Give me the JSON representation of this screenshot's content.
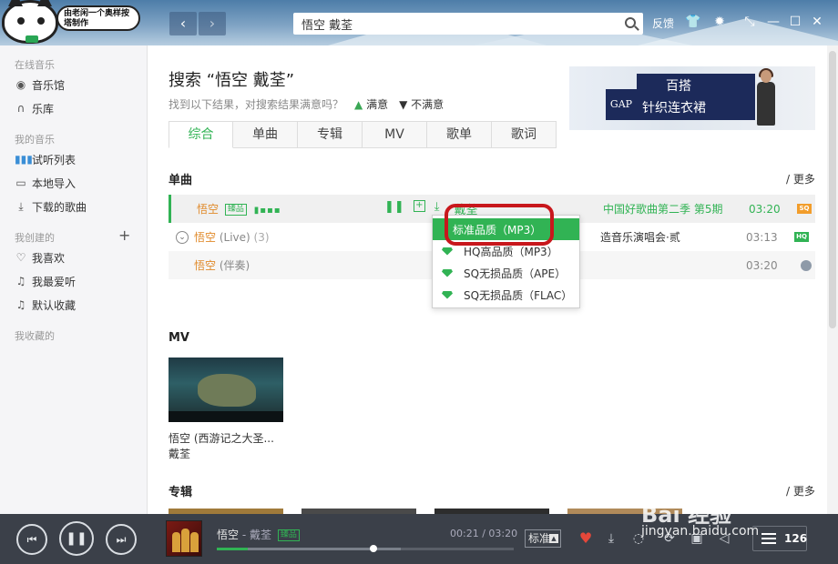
{
  "header": {
    "logo_bubble": "由老闲一个奥样按 塔制作",
    "nav_back": "‹",
    "nav_forward": "›",
    "search_value": "悟空 戴荃",
    "feedback": "反馈"
  },
  "sidebar": {
    "group_online": "在线音乐",
    "music_hall": "音乐馆",
    "library": "乐库",
    "group_my": "我的音乐",
    "trial_list": "试听列表",
    "local_import": "本地导入",
    "downloaded": "下载的歌曲",
    "group_created": "我创建的",
    "add": "+",
    "fav_like": "我喜欢",
    "fav_love": "我最爱听",
    "default_collection": "默认收藏",
    "group_collected": "我收藏的"
  },
  "search": {
    "title": "搜索 “悟空 戴荃”",
    "hint": "找到以下结果，对搜索结果满意吗？",
    "satisfied": "满意",
    "unsatisfied": "不满意"
  },
  "ad": {
    "brand": "GAP",
    "text_line1": "百搭",
    "text_line2": "针织连衣裙"
  },
  "tabs": [
    "综合",
    "单曲",
    "专辑",
    "MV",
    "歌单",
    "歌词"
  ],
  "sections": {
    "songs": "单曲",
    "mv": "MV",
    "albums": "专辑",
    "more": "/ 更多"
  },
  "songs": [
    {
      "name": "悟空",
      "version": "",
      "count": "",
      "tag": "臻品",
      "artist": "戴荃",
      "album": "中国好歌曲第二季 第5期",
      "duration": "03:20",
      "quality": "SQ"
    },
    {
      "name": "悟空",
      "version": "(Live)",
      "count": "(3)",
      "tag": "",
      "artist": "",
      "album": "造音乐演唱会·贰",
      "duration": "03:13",
      "quality": "HQ"
    },
    {
      "name": "悟空",
      "version": "(伴奏)",
      "count": "",
      "tag": "",
      "artist": "",
      "album": "",
      "duration": "03:20",
      "quality": ""
    }
  ],
  "quality_menu": [
    "标准品质（MP3）",
    "HQ高品质（MP3）",
    "SQ无损品质（APE）",
    "SQ无损品质（FLAC）"
  ],
  "mv": {
    "title": "悟空 (西游记之大圣...",
    "artist": "戴荃"
  },
  "player": {
    "track": "悟空",
    "separator": " - ",
    "artist": "戴荃",
    "tag": "臻品",
    "time_current": "00:21",
    "time_total": "03:20",
    "progress": 0.105,
    "buffered": 0.62,
    "quality": "标准",
    "playlist_count": "126"
  },
  "watermark": {
    "text": "Bai 经验",
    "url": "jingyan.baidu.com"
  },
  "colors": {
    "accent": "#31b354",
    "song_name": "#e08a2a",
    "highlight": "#c8171c",
    "player_bg": "#3b4049"
  }
}
